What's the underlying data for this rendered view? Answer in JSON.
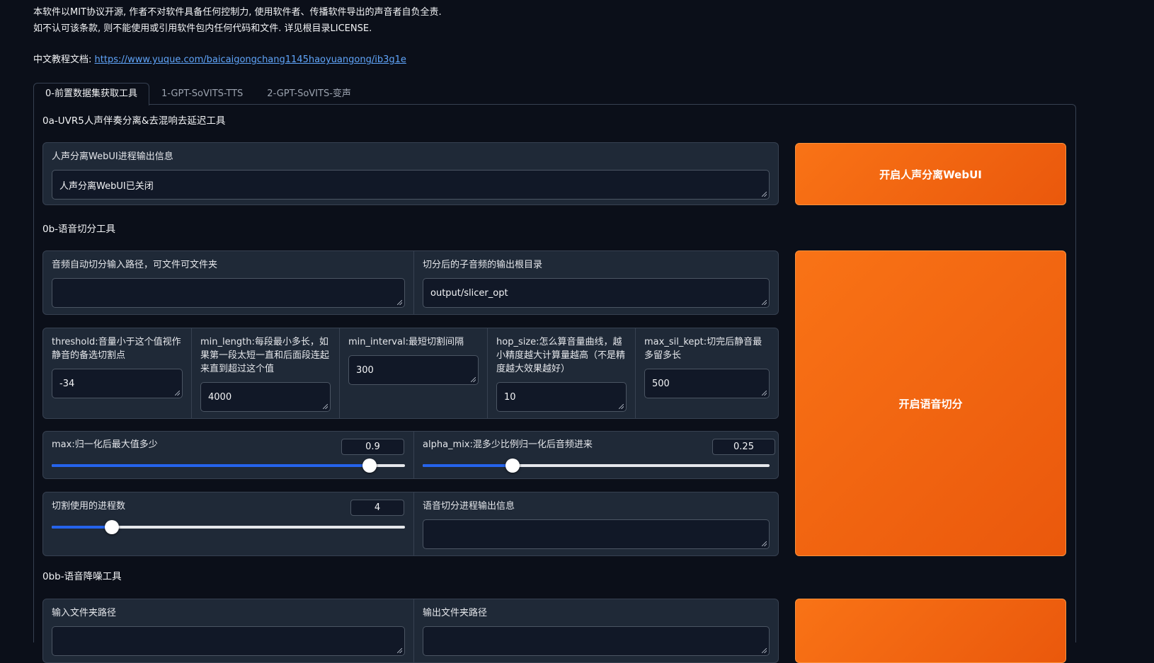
{
  "intro": {
    "line1": "本软件以MIT协议开源, 作者不对软件具备任何控制力, 使用软件者、传播软件导出的声音者自负全责.",
    "line2": "如不认可该条款, 则不能使用或引用软件包内任何代码和文件. 详见根目录LICENSE.",
    "doc_label": "中文教程文档:",
    "doc_link": "https://www.yuque.com/baicaigongchang1145haoyuangong/ib3g1e"
  },
  "tabs": [
    "0-前置数据集获取工具",
    "1-GPT-SoVITS-TTS",
    "2-GPT-SoVITS-变声"
  ],
  "uvr5": {
    "title": "0a-UVR5人声伴奏分离&去混响去延迟工具",
    "info_label": "人声分离WebUI进程输出信息",
    "info_value": "人声分离WebUI已关闭",
    "button": "开启人声分离WebUI"
  },
  "slicer": {
    "title": "0b-语音切分工具",
    "input_label": "音频自动切分输入路径，可文件可文件夹",
    "input_value": "",
    "output_label": "切分后的子音频的输出根目录",
    "output_value": "output/slicer_opt",
    "params": [
      {
        "label": "threshold:音量小于这个值视作静音的备选切割点",
        "value": "-34"
      },
      {
        "label": "min_length:每段最小多长，如果第一段太短一直和后面段连起来直到超过这个值",
        "value": "4000"
      },
      {
        "label": "min_interval:最短切割间隔",
        "value": "300"
      },
      {
        "label": "hop_size:怎么算音量曲线，越小精度越大计算量越高（不是精度越大效果越好）",
        "value": "10"
      },
      {
        "label": "max_sil_kept:切完后静音最多留多长",
        "value": "500"
      }
    ],
    "max_label": "max:归一化后最大值多少",
    "max_value": "0.9",
    "max_fraction": 0.9,
    "alpha_label": "alpha_mix:混多少比例归一化后音频进来",
    "alpha_value": "0.25",
    "alpha_fraction": 0.26,
    "procs_label": "切割使用的进程数",
    "procs_value": "4",
    "procs_fraction": 0.17,
    "log_label": "语音切分进程输出信息",
    "log_value": "",
    "button": "开启语音切分"
  },
  "denoise": {
    "title": "0bb-语音降噪工具",
    "input_label": "输入文件夹路径",
    "output_label": "输出文件夹路径"
  },
  "colors": {
    "accent": "#f97316",
    "slider": "#2563eb",
    "background": "#0b0f19",
    "panel": "#1f2937"
  }
}
